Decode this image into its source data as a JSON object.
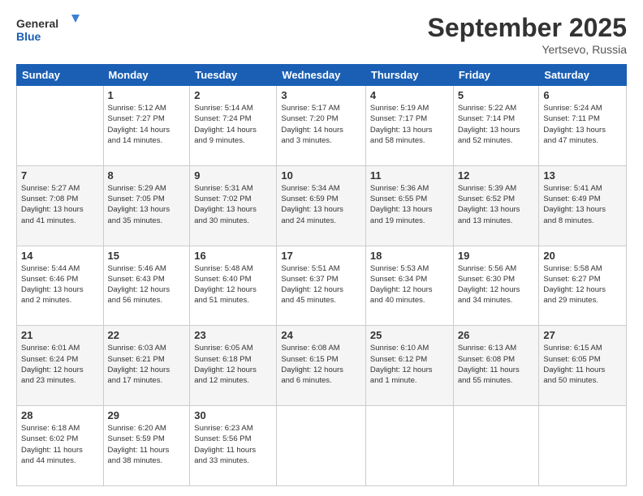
{
  "header": {
    "logo_line1": "General",
    "logo_line2": "Blue",
    "month_title": "September 2025",
    "location": "Yertsevo, Russia"
  },
  "weekdays": [
    "Sunday",
    "Monday",
    "Tuesday",
    "Wednesday",
    "Thursday",
    "Friday",
    "Saturday"
  ],
  "weeks": [
    [
      {
        "day": "",
        "info": ""
      },
      {
        "day": "1",
        "info": "Sunrise: 5:12 AM\nSunset: 7:27 PM\nDaylight: 14 hours\nand 14 minutes."
      },
      {
        "day": "2",
        "info": "Sunrise: 5:14 AM\nSunset: 7:24 PM\nDaylight: 14 hours\nand 9 minutes."
      },
      {
        "day": "3",
        "info": "Sunrise: 5:17 AM\nSunset: 7:20 PM\nDaylight: 14 hours\nand 3 minutes."
      },
      {
        "day": "4",
        "info": "Sunrise: 5:19 AM\nSunset: 7:17 PM\nDaylight: 13 hours\nand 58 minutes."
      },
      {
        "day": "5",
        "info": "Sunrise: 5:22 AM\nSunset: 7:14 PM\nDaylight: 13 hours\nand 52 minutes."
      },
      {
        "day": "6",
        "info": "Sunrise: 5:24 AM\nSunset: 7:11 PM\nDaylight: 13 hours\nand 47 minutes."
      }
    ],
    [
      {
        "day": "7",
        "info": "Sunrise: 5:27 AM\nSunset: 7:08 PM\nDaylight: 13 hours\nand 41 minutes."
      },
      {
        "day": "8",
        "info": "Sunrise: 5:29 AM\nSunset: 7:05 PM\nDaylight: 13 hours\nand 35 minutes."
      },
      {
        "day": "9",
        "info": "Sunrise: 5:31 AM\nSunset: 7:02 PM\nDaylight: 13 hours\nand 30 minutes."
      },
      {
        "day": "10",
        "info": "Sunrise: 5:34 AM\nSunset: 6:59 PM\nDaylight: 13 hours\nand 24 minutes."
      },
      {
        "day": "11",
        "info": "Sunrise: 5:36 AM\nSunset: 6:55 PM\nDaylight: 13 hours\nand 19 minutes."
      },
      {
        "day": "12",
        "info": "Sunrise: 5:39 AM\nSunset: 6:52 PM\nDaylight: 13 hours\nand 13 minutes."
      },
      {
        "day": "13",
        "info": "Sunrise: 5:41 AM\nSunset: 6:49 PM\nDaylight: 13 hours\nand 8 minutes."
      }
    ],
    [
      {
        "day": "14",
        "info": "Sunrise: 5:44 AM\nSunset: 6:46 PM\nDaylight: 13 hours\nand 2 minutes."
      },
      {
        "day": "15",
        "info": "Sunrise: 5:46 AM\nSunset: 6:43 PM\nDaylight: 12 hours\nand 56 minutes."
      },
      {
        "day": "16",
        "info": "Sunrise: 5:48 AM\nSunset: 6:40 PM\nDaylight: 12 hours\nand 51 minutes."
      },
      {
        "day": "17",
        "info": "Sunrise: 5:51 AM\nSunset: 6:37 PM\nDaylight: 12 hours\nand 45 minutes."
      },
      {
        "day": "18",
        "info": "Sunrise: 5:53 AM\nSunset: 6:34 PM\nDaylight: 12 hours\nand 40 minutes."
      },
      {
        "day": "19",
        "info": "Sunrise: 5:56 AM\nSunset: 6:30 PM\nDaylight: 12 hours\nand 34 minutes."
      },
      {
        "day": "20",
        "info": "Sunrise: 5:58 AM\nSunset: 6:27 PM\nDaylight: 12 hours\nand 29 minutes."
      }
    ],
    [
      {
        "day": "21",
        "info": "Sunrise: 6:01 AM\nSunset: 6:24 PM\nDaylight: 12 hours\nand 23 minutes."
      },
      {
        "day": "22",
        "info": "Sunrise: 6:03 AM\nSunset: 6:21 PM\nDaylight: 12 hours\nand 17 minutes."
      },
      {
        "day": "23",
        "info": "Sunrise: 6:05 AM\nSunset: 6:18 PM\nDaylight: 12 hours\nand 12 minutes."
      },
      {
        "day": "24",
        "info": "Sunrise: 6:08 AM\nSunset: 6:15 PM\nDaylight: 12 hours\nand 6 minutes."
      },
      {
        "day": "25",
        "info": "Sunrise: 6:10 AM\nSunset: 6:12 PM\nDaylight: 12 hours\nand 1 minute."
      },
      {
        "day": "26",
        "info": "Sunrise: 6:13 AM\nSunset: 6:08 PM\nDaylight: 11 hours\nand 55 minutes."
      },
      {
        "day": "27",
        "info": "Sunrise: 6:15 AM\nSunset: 6:05 PM\nDaylight: 11 hours\nand 50 minutes."
      }
    ],
    [
      {
        "day": "28",
        "info": "Sunrise: 6:18 AM\nSunset: 6:02 PM\nDaylight: 11 hours\nand 44 minutes."
      },
      {
        "day": "29",
        "info": "Sunrise: 6:20 AM\nSunset: 5:59 PM\nDaylight: 11 hours\nand 38 minutes."
      },
      {
        "day": "30",
        "info": "Sunrise: 6:23 AM\nSunset: 5:56 PM\nDaylight: 11 hours\nand 33 minutes."
      },
      {
        "day": "",
        "info": ""
      },
      {
        "day": "",
        "info": ""
      },
      {
        "day": "",
        "info": ""
      },
      {
        "day": "",
        "info": ""
      }
    ]
  ]
}
